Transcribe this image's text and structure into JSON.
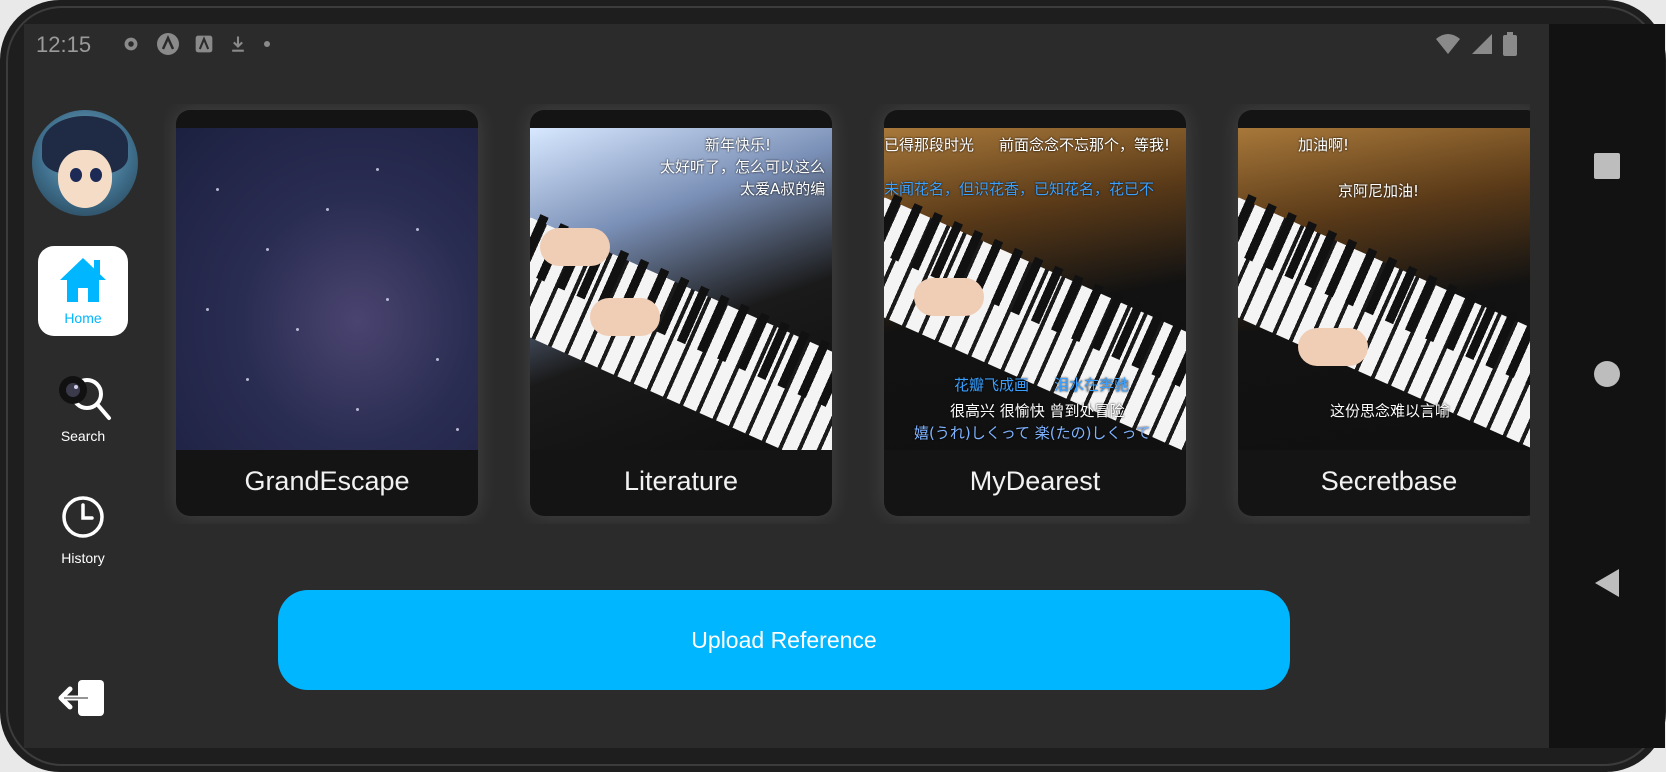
{
  "status_bar": {
    "time": "12:15"
  },
  "sidebar": {
    "items": [
      {
        "label": "Home",
        "icon": "home-icon",
        "active": true
      },
      {
        "label": "Search",
        "icon": "search-icon",
        "active": false
      },
      {
        "label": "History",
        "icon": "clock-icon",
        "active": false
      }
    ],
    "logout_icon": "logout-icon"
  },
  "cards": [
    {
      "title": "GrandEscape",
      "thumbnail": "starry-sky",
      "overlay_text": []
    },
    {
      "title": "Literature",
      "thumbnail": "piano-performance",
      "overlay_text": [
        "新年快乐!",
        "太好听了，怎么可以这么",
        "太爱A叔的编"
      ]
    },
    {
      "title": "MyDearest",
      "thumbnail": "grand-piano-performance",
      "overlay_text": [
        "已得那段时光",
        "前面念念不忘那个，等我!",
        "未闻花名，但识花香，已知花名，花已不",
        "花瓣飞成画",
        "泪水在奔驰",
        "很高兴 很愉快 曾到处冒险",
        "嬉(うれ)しくって 楽(たの)しくって"
      ]
    },
    {
      "title": "Secretbase",
      "thumbnail": "grand-piano-performance",
      "overlay_text": [
        "加油啊!",
        "京阿尼加油!",
        "这份思念难以言喻"
      ]
    }
  ],
  "upload_button": {
    "label": "Upload Reference"
  },
  "colors": {
    "accent": "#00b6ff",
    "background": "#2b2b2b",
    "card": "#141414"
  }
}
